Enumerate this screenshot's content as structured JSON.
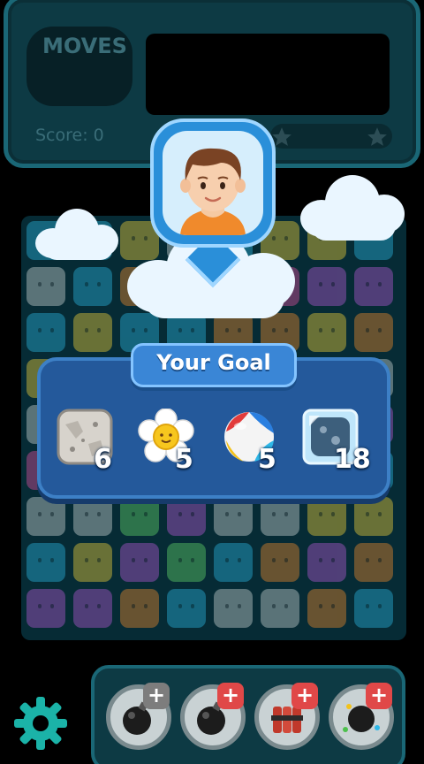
{
  "hud": {
    "moves_label": "MOVES",
    "score_label": "Score: 0"
  },
  "goal": {
    "title": "Your Goal",
    "items": [
      {
        "name": "stone-block",
        "count": "6"
      },
      {
        "name": "flower",
        "count": "5"
      },
      {
        "name": "beach-ball",
        "count": "5"
      },
      {
        "name": "ice-block",
        "count": "18"
      }
    ]
  },
  "boosters": [
    {
      "name": "bomb",
      "badge": "plus"
    },
    {
      "name": "bomb",
      "badge": "plus"
    },
    {
      "name": "dynamite",
      "badge": "plus"
    },
    {
      "name": "fireworks-bomb",
      "badge": "plus"
    }
  ],
  "colors": {
    "hud_bg": "#0d3a44",
    "panel_bg": "#24599b",
    "title_bg": "#3a86d6",
    "plus_grey": "#7d7d7d",
    "plus_red": "#e04848",
    "settings_teal": "#1bb3a8"
  },
  "icons": [
    "gear-icon",
    "star-icon",
    "plus-icon"
  ]
}
